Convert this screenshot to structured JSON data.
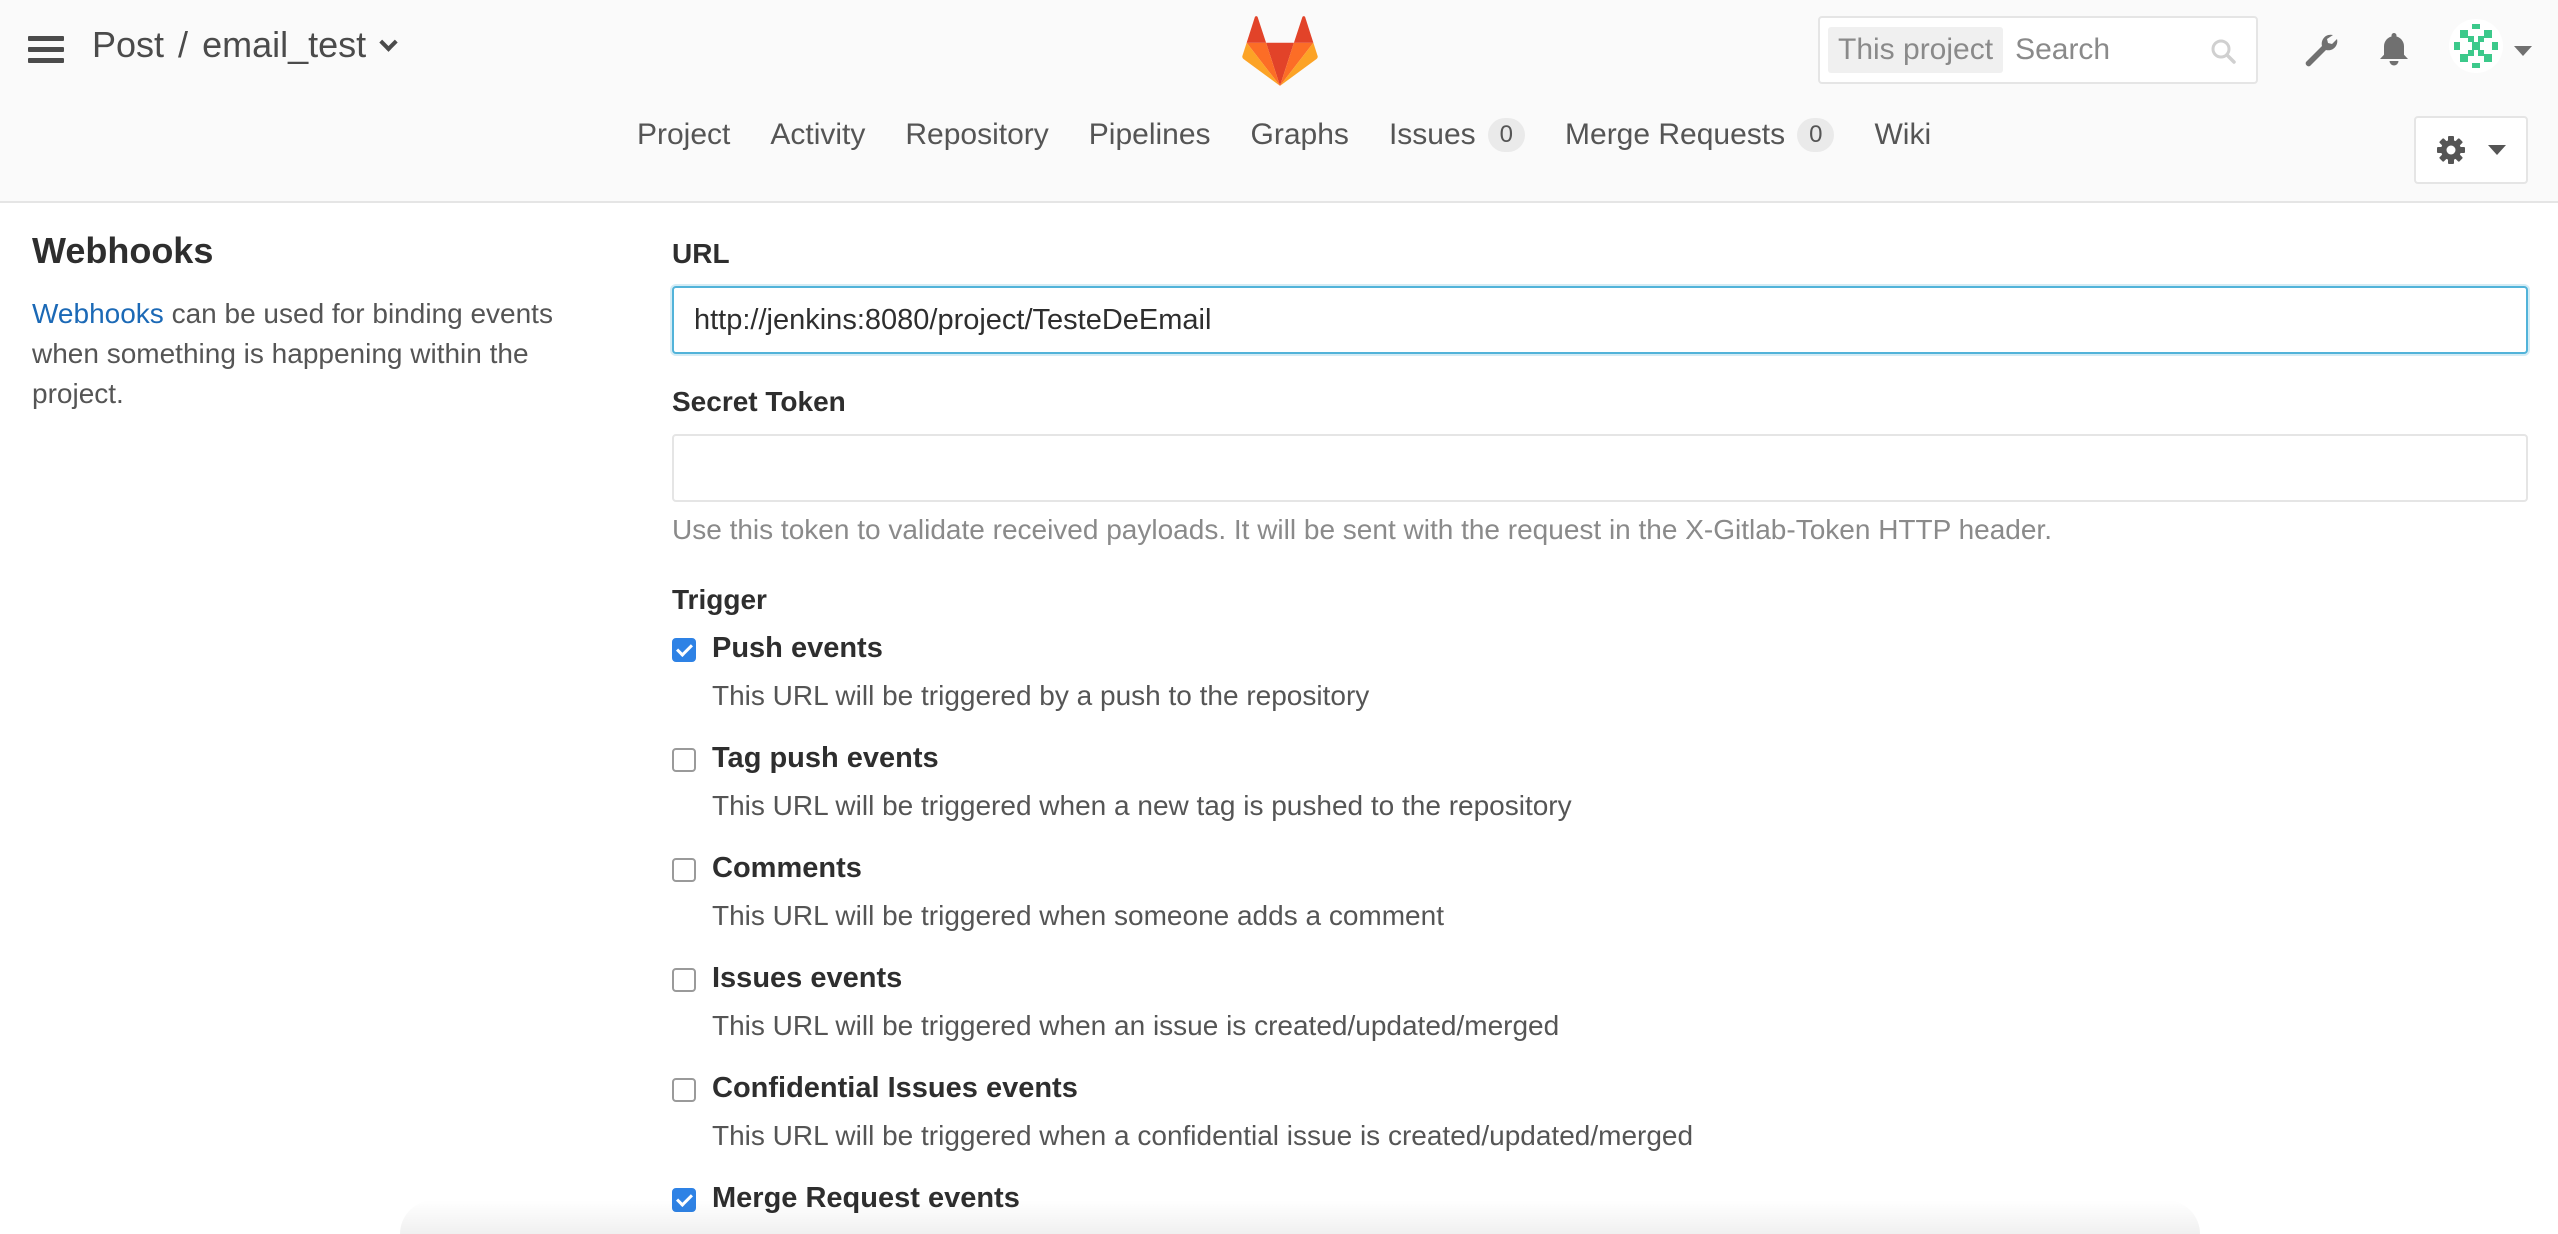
{
  "header": {
    "namespace": "Post",
    "separator": "/",
    "project": "email_test",
    "search": {
      "scope": "This project",
      "placeholder": "Search"
    },
    "icons": {
      "menu": "hamburger-icon",
      "logo": "gitlab-fox-logo",
      "search": "magnifier-icon",
      "admin": "wrench-icon",
      "notifications": "bell-icon",
      "avatar": "identicon-avatar",
      "settings": "gear-icon"
    }
  },
  "nav": {
    "items": [
      {
        "label": "Project"
      },
      {
        "label": "Activity"
      },
      {
        "label": "Repository"
      },
      {
        "label": "Pipelines"
      },
      {
        "label": "Graphs"
      },
      {
        "label": "Issues",
        "count": "0"
      },
      {
        "label": "Merge Requests",
        "count": "0"
      },
      {
        "label": "Wiki"
      }
    ]
  },
  "sidebar": {
    "title": "Webhooks",
    "link_text": "Webhooks",
    "description": " can be used for binding events when something is happening within the project."
  },
  "form": {
    "url_label": "URL",
    "url_value": "http://jenkins:8080/project/TesteDeEmail",
    "token_label": "Secret Token",
    "token_value": "",
    "token_help": "Use this token to validate received payloads. It will be sent with the request in the X-Gitlab-Token HTTP header.",
    "trigger_label": "Trigger",
    "triggers": [
      {
        "name": "Push events",
        "desc": "This URL will be triggered by a push to the repository",
        "checked": true
      },
      {
        "name": "Tag push events",
        "desc": "This URL will be triggered when a new tag is pushed to the repository",
        "checked": false
      },
      {
        "name": "Comments",
        "desc": "This URL will be triggered when someone adds a comment",
        "checked": false
      },
      {
        "name": "Issues events",
        "desc": "This URL will be triggered when an issue is created/updated/merged",
        "checked": false
      },
      {
        "name": "Confidential Issues events",
        "desc": "This URL will be triggered when a confidential issue is created/updated/merged",
        "checked": false
      },
      {
        "name": "Merge Request events",
        "desc": "",
        "checked": true
      }
    ]
  },
  "colors": {
    "accent": "#1b69b6",
    "focus_border": "#52b3d9",
    "checkbox_on": "#2e82e5",
    "logo_orange": "#fc6d26",
    "logo_red": "#e24329",
    "logo_light": "#fca326",
    "avatar_green": "#3cc98b"
  }
}
